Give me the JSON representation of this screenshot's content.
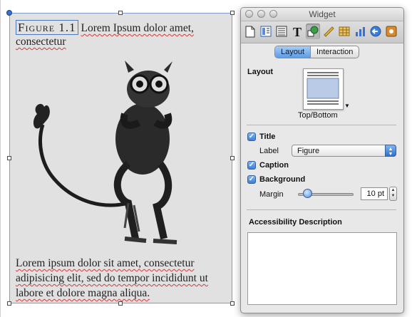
{
  "figure": {
    "label": "Figure 1.1",
    "title_text": "Lorem Ipsum dolor amet, consectetur",
    "body_text": "Lorem ipsum dolor sit amet, consectetur adipisicing elit, sed do tempor incididunt ut labore et dolore magna aliqua.",
    "image": "tarsier-illustration"
  },
  "inspector": {
    "window_title": "Widget",
    "toolbar_icons": [
      "document-icon",
      "layout-icon",
      "wrap-icon",
      "text-icon",
      "graphic-icon",
      "metrics-icon",
      "table-icon",
      "chart-icon",
      "link-icon",
      "widget-icon"
    ],
    "tabs": [
      "Layout",
      "Interaction"
    ],
    "active_tab": "Layout",
    "layout_section": "Layout",
    "layout_option": "Top/Bottom",
    "title_checkbox": {
      "label": "Title",
      "checked": true
    },
    "label_field": {
      "label": "Label",
      "value": "Figure"
    },
    "caption_checkbox": {
      "label": "Caption",
      "checked": true
    },
    "background_checkbox": {
      "label": "Background",
      "checked": true
    },
    "margin": {
      "label": "Margin",
      "value": "10 pt",
      "slider_fraction": 0.1
    },
    "accessibility_title": "Accessibility Description",
    "accessibility_text": ""
  },
  "colors": {
    "figure_background": "#e1e1e1",
    "selection_blue": "#4b78c2",
    "accent_blue": "#3c7fd8"
  }
}
